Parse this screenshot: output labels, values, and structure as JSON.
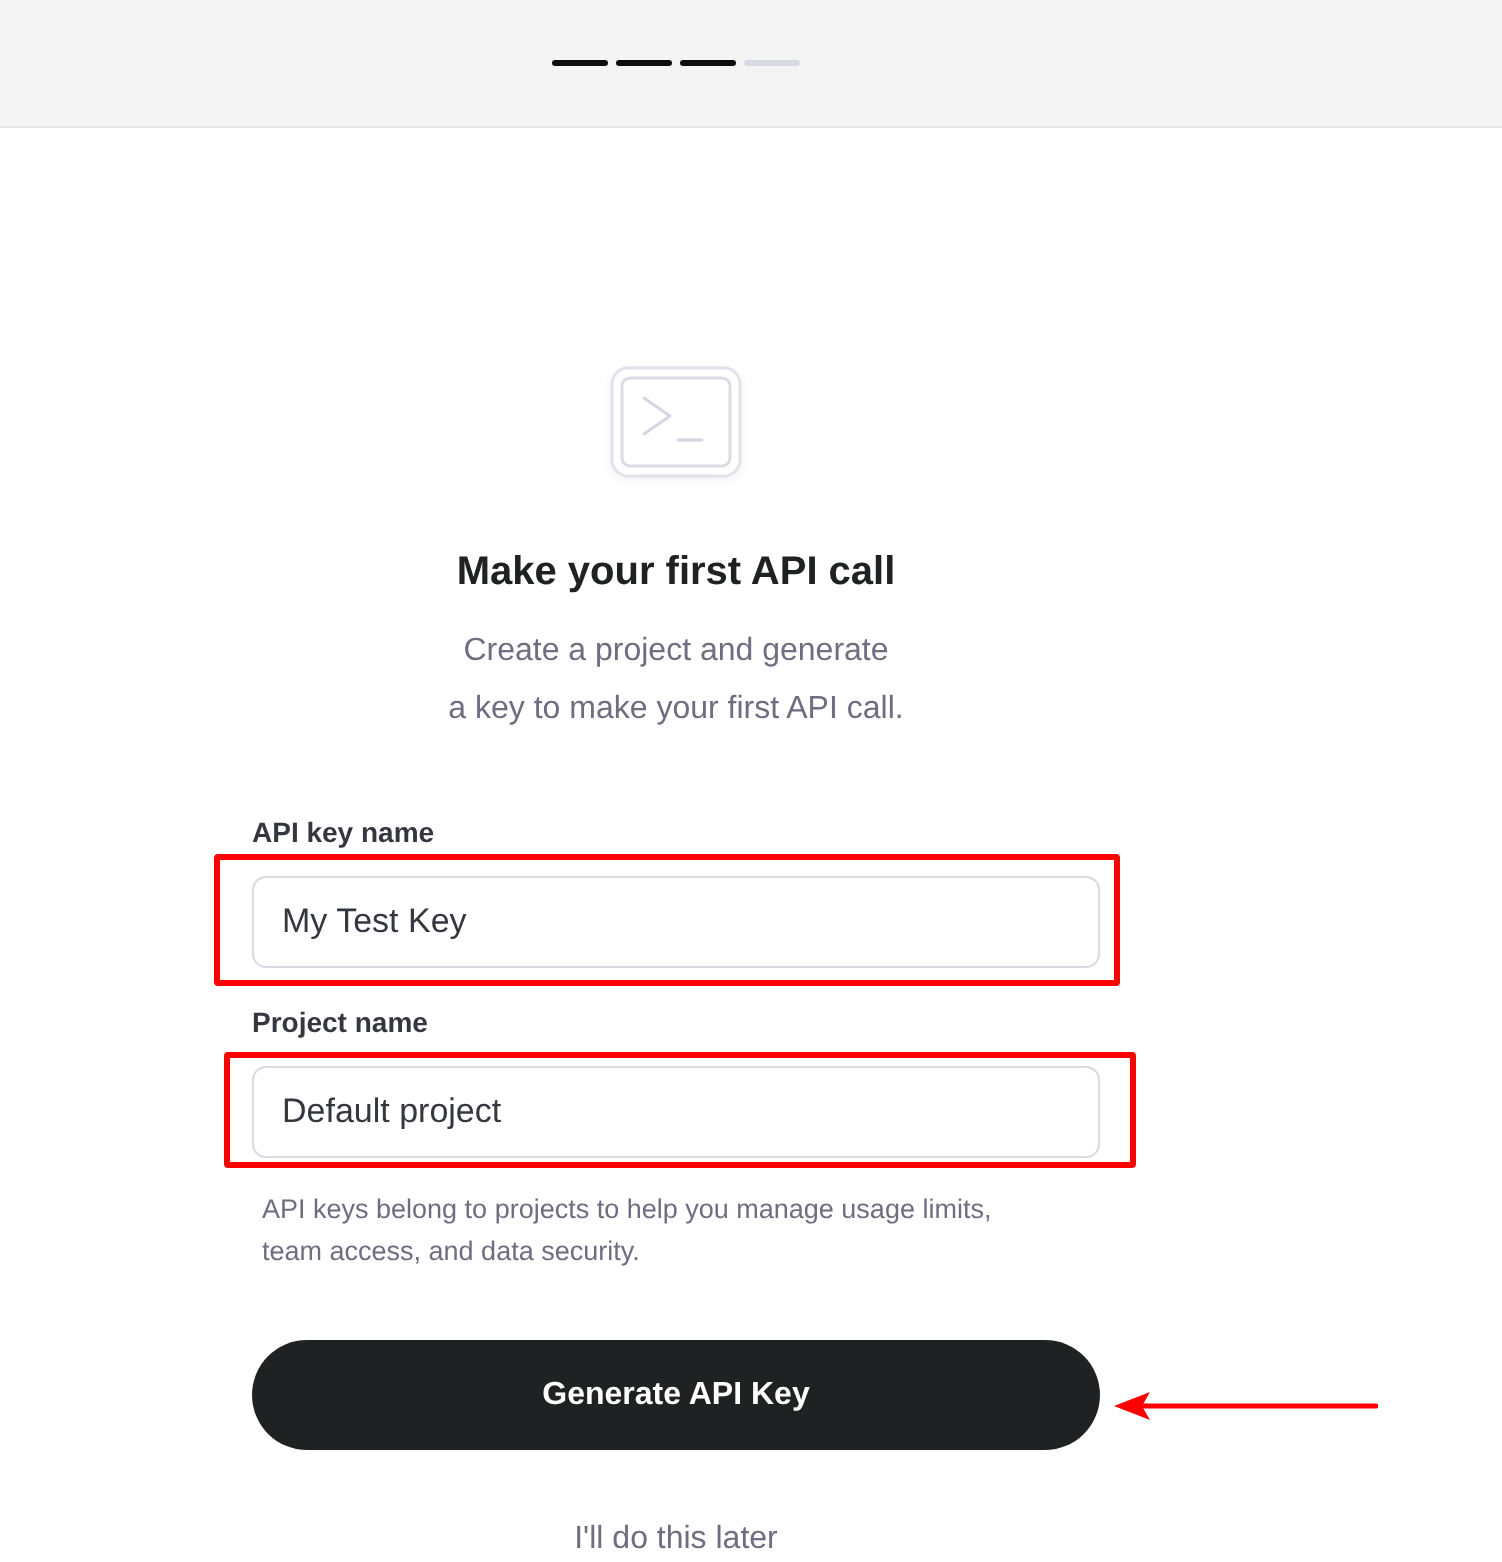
{
  "progress": {
    "steps": [
      {
        "done": true
      },
      {
        "done": true
      },
      {
        "done": true
      },
      {
        "done": false
      }
    ]
  },
  "hero": {
    "title": "Make your first API call",
    "subtitle_lines": [
      "Create a project and generate",
      "a key to make your first API call."
    ]
  },
  "fields": [
    {
      "label": "API key name",
      "value": "My Test Key",
      "highlighted": true
    },
    {
      "label": "Project name",
      "value": "Default project",
      "highlighted": true
    }
  ],
  "help_lines": [
    "API keys belong to projects to help you manage usage limits,",
    "team access, and data security."
  ],
  "primary_button": {
    "label": "Generate API Key",
    "pointed_at": true
  },
  "secondary_link": {
    "label": "I'll do this later"
  }
}
